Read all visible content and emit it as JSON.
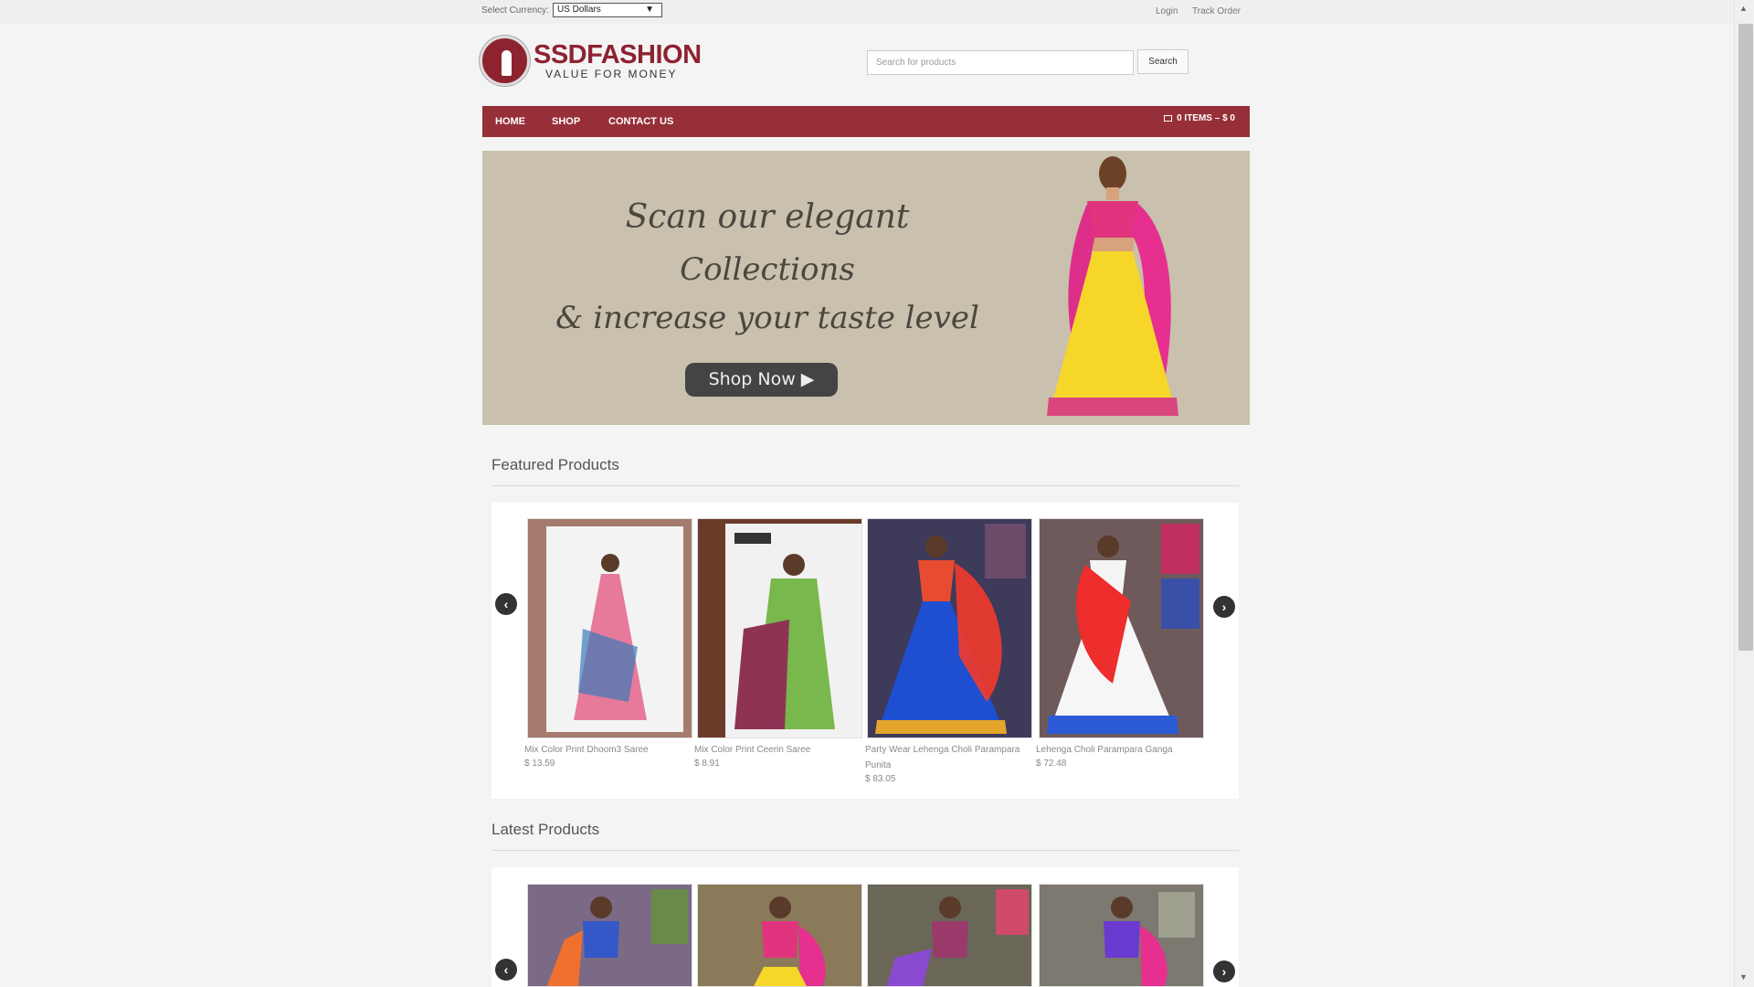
{
  "topbar": {
    "currency_label": "Select Currency:",
    "currency_value": "US Dollars",
    "login": "Login",
    "track_order": "Track Order"
  },
  "logo": {
    "title": "SSDFASHION",
    "tagline": "VALUE FOR MONEY"
  },
  "search": {
    "placeholder": "Search for products",
    "button": "Search"
  },
  "nav": {
    "items": [
      "HOME",
      "SHOP",
      "CONTACT US"
    ],
    "cart": "0 ITEMS – $ 0"
  },
  "hero": {
    "line1": "Scan our elegant",
    "line2": "Collections",
    "line3": "& increase your taste level",
    "button": "Shop Now ▶"
  },
  "featured": {
    "title": "Featured Products",
    "products": [
      {
        "name": "Mix Color Print Dhoom3 Saree",
        "price": "$ 13.59"
      },
      {
        "name": "Mix Color Print Ceerin Saree",
        "price": "$ 8.91"
      },
      {
        "name": "Party Wear Lehenga Choli Parampara Punita",
        "price": "$ 83.05"
      },
      {
        "name": "Lehenga Choli Parampara Ganga",
        "price": "$ 72.48"
      }
    ]
  },
  "latest": {
    "title": "Latest Products"
  },
  "colors": {
    "brand": "#962f38",
    "hero_bg": "#c9c0ad"
  }
}
